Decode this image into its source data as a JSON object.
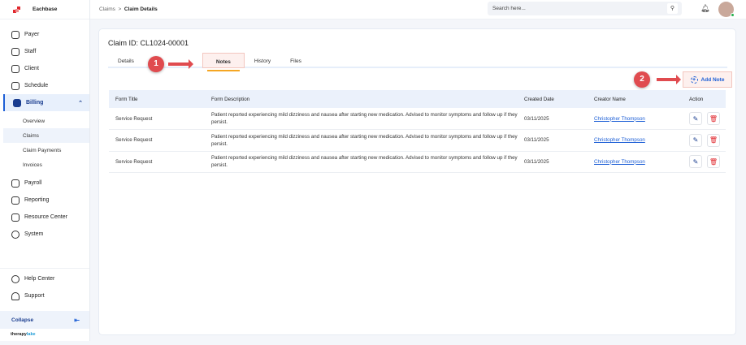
{
  "app": {
    "name": "Eachbase",
    "brand": "therapylake"
  },
  "sidebar": {
    "items": [
      {
        "label": "Payer"
      },
      {
        "label": "Staff"
      },
      {
        "label": "Client"
      },
      {
        "label": "Schedule"
      },
      {
        "label": "Billing"
      }
    ],
    "billing_sub": [
      {
        "label": "Overview"
      },
      {
        "label": "Claims"
      },
      {
        "label": "Claim Payments"
      },
      {
        "label": "Invoices"
      }
    ],
    "items2": [
      {
        "label": "Payroll"
      },
      {
        "label": "Reporting"
      },
      {
        "label": "Resource Center"
      },
      {
        "label": "System"
      }
    ],
    "bottom": [
      {
        "label": "Help Center"
      },
      {
        "label": "Support"
      }
    ],
    "collapse": "Collapse"
  },
  "breadcrumb": {
    "parent": "Claims",
    "sep": ">",
    "current": "Claim Details"
  },
  "search": {
    "placeholder": "Search here..."
  },
  "page": {
    "title": "Claim ID: CL1024-00001",
    "tabs": [
      {
        "label": "Details"
      },
      {
        "label": "Notes"
      },
      {
        "label": "History"
      },
      {
        "label": "Files"
      }
    ],
    "add_note": "Add Note"
  },
  "annotations": [
    "1",
    "2"
  ],
  "table": {
    "headers": [
      "Form Title",
      "Form Description",
      "Created Date",
      "Creator Name",
      "Action"
    ],
    "rows": [
      {
        "title": "Service Request",
        "desc": "Patient reported experiencing mild dizziness and nausea after starting new medication. Advised to monitor symptoms and follow up if they persist.",
        "date": "03/11/2025",
        "creator": "Christopher Thompson"
      },
      {
        "title": "Service Request",
        "desc": "Patient reported experiencing mild dizziness and nausea after starting new medication. Advised to monitor symptoms and follow up if they persist.",
        "date": "03/11/2025",
        "creator": "Christopher Thompson"
      },
      {
        "title": "Service Request",
        "desc": "Patient reported experiencing mild dizziness and nausea after starting new medication. Advised to monitor symptoms and follow up if they persist.",
        "date": "03/11/2025",
        "creator": "Christopher Thompson"
      }
    ]
  }
}
